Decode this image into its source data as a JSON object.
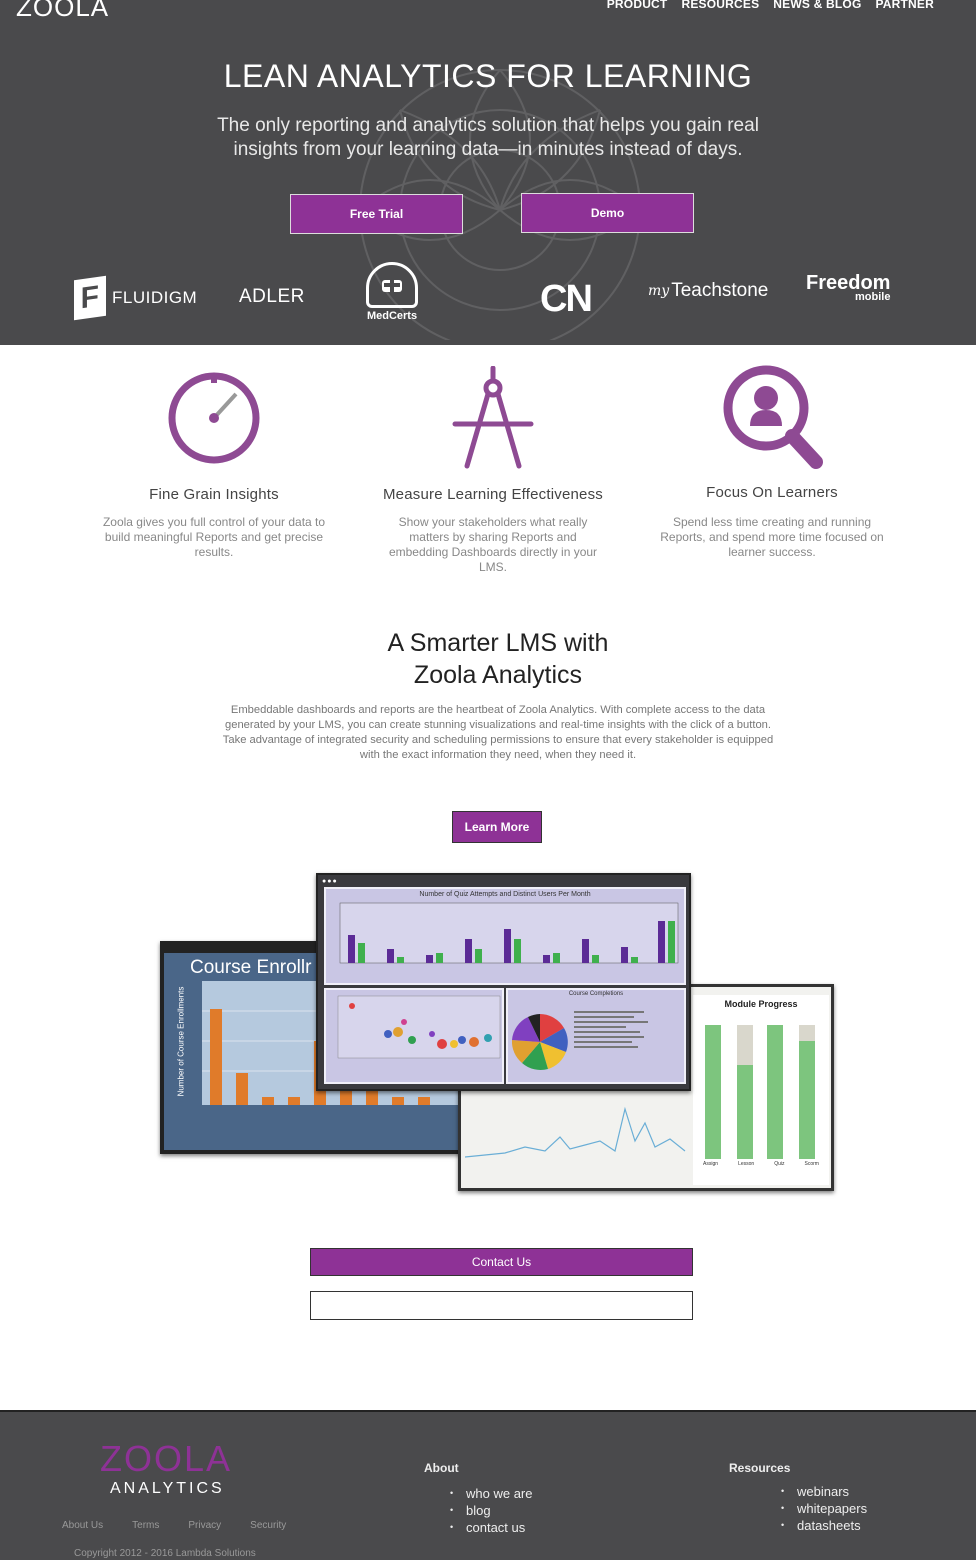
{
  "header": {
    "logo": "ZOOLA",
    "nav": [
      "PRODUCT",
      "RESOURCES",
      "NEWS & BLOG",
      "PARTNER"
    ]
  },
  "hero": {
    "title": "LEAN ANALYTICS FOR LEARNING",
    "subtitle_line1": "The only reporting and analytics solution that helps you gain real",
    "subtitle_line2": "insights from your learning data—in minutes instead of days.",
    "btn_trial": "Free Trial",
    "btn_demo": "Demo"
  },
  "clients": {
    "fluidigm": "FLUIDIGM",
    "fluidigm_mark": "F",
    "adler": "ADLER",
    "medcerts": "MedCerts",
    "cn": "CN",
    "teach_my": "my",
    "teach": "Teachstone",
    "freedom": "Freedom",
    "freedom_sub": "mobile"
  },
  "features": [
    {
      "title": "Fine Grain Insights",
      "text": "Zoola gives you full control of your data to build meaningful Reports and get precise results."
    },
    {
      "title": "Measure Learning Effectiveness",
      "text": "Show your stakeholders what really matters by sharing Reports and embedding Dashboards directly in your LMS."
    },
    {
      "title": "Focus On Learners",
      "text": "Spend less time creating and running Reports, and spend more time focused on learner success."
    }
  ],
  "smart": {
    "title_line1": "A Smarter LMS with",
    "title_line2": "Zoola Analytics",
    "text": "Embeddable dashboards and reports are the heartbeat of Zoola Analytics. With complete access to the data generated by your LMS, you can create stunning visualizations and real-time insights with the click of a button. Take advantage of integrated security and scheduling permissions to ensure that every stakeholder is equipped with the exact information they need, when they need it.",
    "btn": "Learn More"
  },
  "screens": {
    "enroll_title": "Course Enrollr",
    "enroll_ylabel": "Number of Course Enrollments",
    "dash_title": "Number of Quiz Attempts and Distinct Users Per Month",
    "pie_title": "Course Completions",
    "progress_title": "Module Progress",
    "progress_labels": [
      "Assign",
      "Lesson",
      "Quiz",
      "Scorm"
    ]
  },
  "contact": {
    "btn": "Contact Us"
  },
  "footer": {
    "logo": "ZOOLA",
    "logo_sub": "ANALYTICS",
    "links": [
      "About Us",
      "Terms",
      "Privacy",
      "Security"
    ],
    "copyright": "Copyright  2012   - 2016   Lambda Solutions",
    "about_title": "About",
    "about_items": [
      "who we are",
      "blog",
      "contact us"
    ],
    "resources_title": "Resources",
    "resources_items": [
      "webinars",
      "whitepapers",
      "datasheets"
    ]
  },
  "colors": {
    "brand_purple": "#8e3296",
    "hero_bg": "#4a4a4c"
  }
}
